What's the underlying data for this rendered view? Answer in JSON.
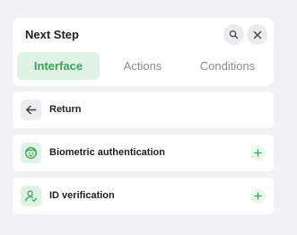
{
  "header": {
    "title": "Next Step",
    "search_icon": "search-icon",
    "close_icon": "close-icon"
  },
  "tabs": [
    {
      "label": "Interface",
      "active": true
    },
    {
      "label": "Actions",
      "active": false
    },
    {
      "label": "Conditions",
      "active": false
    }
  ],
  "items": [
    {
      "label": "Return",
      "icon": "arrow-left-icon",
      "addable": false
    },
    {
      "label": "Biometric authentication",
      "icon": "face-icon",
      "addable": true
    },
    {
      "label": "ID verification",
      "icon": "user-check-icon",
      "addable": true
    }
  ],
  "colors": {
    "accent": "#32a854",
    "accent_bg": "#dff3e5",
    "background": "#f2f2f4"
  }
}
